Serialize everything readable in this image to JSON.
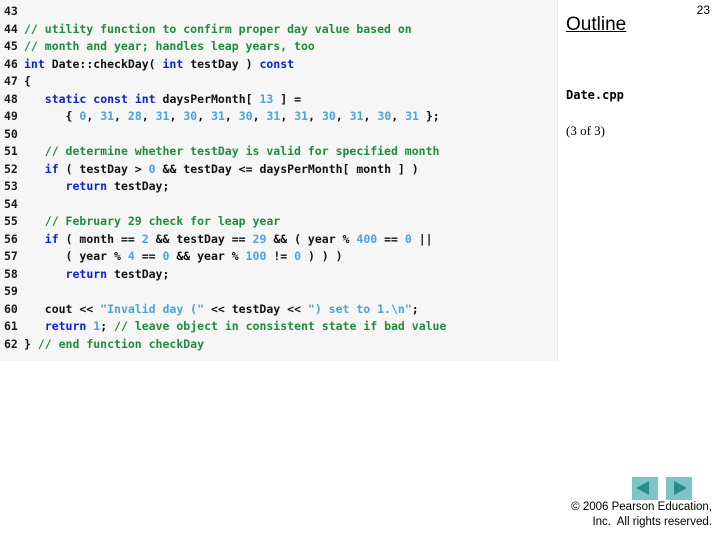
{
  "slide": {
    "page_number": "23",
    "outline_title": "Outline",
    "file_name": "Date.cpp",
    "slide_count": "(3 of 3)",
    "copyright_line1": "© 2006 Pearson Education,",
    "copyright_line2": "Inc.  All rights reserved."
  },
  "nav": {
    "prev_label": "previous-slide",
    "next_label": "next-slide",
    "button_color": "#7ec5c6",
    "arrow_color": "#2f8a8c"
  },
  "colors": {
    "code_background": "#f6f6f6",
    "comment": "#1f8b3d",
    "keyword": "#0a22cc",
    "number": "#4aa3dd",
    "string": "#4aa3dd",
    "identifier": "#111111"
  },
  "code": {
    "language": "cpp",
    "first_line": 43,
    "last_line": 62,
    "lines": [
      {
        "n": "43",
        "tokens": []
      },
      {
        "n": "44",
        "tokens": [
          {
            "t": "// utility function to confirm proper day value based on",
            "c": "c-com"
          }
        ]
      },
      {
        "n": "45",
        "tokens": [
          {
            "t": "// month and year; handles leap years, too",
            "c": "c-com"
          }
        ]
      },
      {
        "n": "46",
        "tokens": [
          {
            "t": "int",
            "c": "c-kw"
          },
          {
            "t": " Date::checkDay( ",
            "c": "c-id"
          },
          {
            "t": "int",
            "c": "c-kw"
          },
          {
            "t": " testDay ) ",
            "c": "c-id"
          },
          {
            "t": "const",
            "c": "c-kw"
          }
        ]
      },
      {
        "n": "47",
        "tokens": [
          {
            "t": "{",
            "c": "c-id"
          }
        ]
      },
      {
        "n": "48",
        "tokens": [
          {
            "t": "   ",
            "c": "c-id"
          },
          {
            "t": "static",
            "c": "c-kw"
          },
          {
            "t": " ",
            "c": "c-id"
          },
          {
            "t": "const",
            "c": "c-kw"
          },
          {
            "t": " ",
            "c": "c-id"
          },
          {
            "t": "int",
            "c": "c-kw"
          },
          {
            "t": " daysPerMonth[ ",
            "c": "c-id"
          },
          {
            "t": "13",
            "c": "c-num"
          },
          {
            "t": " ] =",
            "c": "c-id"
          }
        ]
      },
      {
        "n": "49",
        "tokens": [
          {
            "t": "      { ",
            "c": "c-id"
          },
          {
            "t": "0",
            "c": "c-num"
          },
          {
            "t": ", ",
            "c": "c-id"
          },
          {
            "t": "31",
            "c": "c-num"
          },
          {
            "t": ", ",
            "c": "c-id"
          },
          {
            "t": "28",
            "c": "c-num"
          },
          {
            "t": ", ",
            "c": "c-id"
          },
          {
            "t": "31",
            "c": "c-num"
          },
          {
            "t": ", ",
            "c": "c-id"
          },
          {
            "t": "30",
            "c": "c-num"
          },
          {
            "t": ", ",
            "c": "c-id"
          },
          {
            "t": "31",
            "c": "c-num"
          },
          {
            "t": ", ",
            "c": "c-id"
          },
          {
            "t": "30",
            "c": "c-num"
          },
          {
            "t": ", ",
            "c": "c-id"
          },
          {
            "t": "31",
            "c": "c-num"
          },
          {
            "t": ", ",
            "c": "c-id"
          },
          {
            "t": "31",
            "c": "c-num"
          },
          {
            "t": ", ",
            "c": "c-id"
          },
          {
            "t": "30",
            "c": "c-num"
          },
          {
            "t": ", ",
            "c": "c-id"
          },
          {
            "t": "31",
            "c": "c-num"
          },
          {
            "t": ", ",
            "c": "c-id"
          },
          {
            "t": "30",
            "c": "c-num"
          },
          {
            "t": ", ",
            "c": "c-id"
          },
          {
            "t": "31",
            "c": "c-num"
          },
          {
            "t": " };",
            "c": "c-id"
          }
        ]
      },
      {
        "n": "50",
        "tokens": []
      },
      {
        "n": "51",
        "tokens": [
          {
            "t": "   ",
            "c": "c-id"
          },
          {
            "t": "// determine whether testDay is valid for specified month",
            "c": "c-com"
          }
        ]
      },
      {
        "n": "52",
        "tokens": [
          {
            "t": "   ",
            "c": "c-id"
          },
          {
            "t": "if",
            "c": "c-kw"
          },
          {
            "t": " ( testDay > ",
            "c": "c-id"
          },
          {
            "t": "0",
            "c": "c-num"
          },
          {
            "t": " && testDay <= daysPerMonth[ month ] )",
            "c": "c-id"
          }
        ]
      },
      {
        "n": "53",
        "tokens": [
          {
            "t": "      ",
            "c": "c-id"
          },
          {
            "t": "return",
            "c": "c-kw"
          },
          {
            "t": " testDay;",
            "c": "c-id"
          }
        ]
      },
      {
        "n": "54",
        "tokens": []
      },
      {
        "n": "55",
        "tokens": [
          {
            "t": "   ",
            "c": "c-id"
          },
          {
            "t": "// February 29 check for leap year",
            "c": "c-com"
          }
        ]
      },
      {
        "n": "56",
        "tokens": [
          {
            "t": "   ",
            "c": "c-id"
          },
          {
            "t": "if",
            "c": "c-kw"
          },
          {
            "t": " ( month == ",
            "c": "c-id"
          },
          {
            "t": "2",
            "c": "c-num"
          },
          {
            "t": " && testDay == ",
            "c": "c-id"
          },
          {
            "t": "29",
            "c": "c-num"
          },
          {
            "t": " && ( year % ",
            "c": "c-id"
          },
          {
            "t": "400",
            "c": "c-num"
          },
          {
            "t": " == ",
            "c": "c-id"
          },
          {
            "t": "0",
            "c": "c-num"
          },
          {
            "t": " ||",
            "c": "c-id"
          }
        ]
      },
      {
        "n": "57",
        "tokens": [
          {
            "t": "      ( year % ",
            "c": "c-id"
          },
          {
            "t": "4",
            "c": "c-num"
          },
          {
            "t": " == ",
            "c": "c-id"
          },
          {
            "t": "0",
            "c": "c-num"
          },
          {
            "t": " && year % ",
            "c": "c-id"
          },
          {
            "t": "100",
            "c": "c-num"
          },
          {
            "t": " != ",
            "c": "c-id"
          },
          {
            "t": "0",
            "c": "c-num"
          },
          {
            "t": " ) ) )",
            "c": "c-id"
          }
        ]
      },
      {
        "n": "58",
        "tokens": [
          {
            "t": "      ",
            "c": "c-id"
          },
          {
            "t": "return",
            "c": "c-kw"
          },
          {
            "t": " testDay;",
            "c": "c-id"
          }
        ]
      },
      {
        "n": "59",
        "tokens": []
      },
      {
        "n": "60",
        "tokens": [
          {
            "t": "   cout << ",
            "c": "c-id"
          },
          {
            "t": "\"Invalid day (\"",
            "c": "c-str"
          },
          {
            "t": " << testDay << ",
            "c": "c-id"
          },
          {
            "t": "\") set to 1.\\n\"",
            "c": "c-str"
          },
          {
            "t": ";",
            "c": "c-id"
          }
        ]
      },
      {
        "n": "61",
        "tokens": [
          {
            "t": "   ",
            "c": "c-id"
          },
          {
            "t": "return",
            "c": "c-kw"
          },
          {
            "t": " ",
            "c": "c-id"
          },
          {
            "t": "1",
            "c": "c-num"
          },
          {
            "t": "; ",
            "c": "c-id"
          },
          {
            "t": "// leave object in consistent state if bad value",
            "c": "c-com"
          }
        ]
      },
      {
        "n": "62",
        "tokens": [
          {
            "t": "} ",
            "c": "c-id"
          },
          {
            "t": "// end function checkDay",
            "c": "c-com"
          }
        ]
      }
    ]
  }
}
